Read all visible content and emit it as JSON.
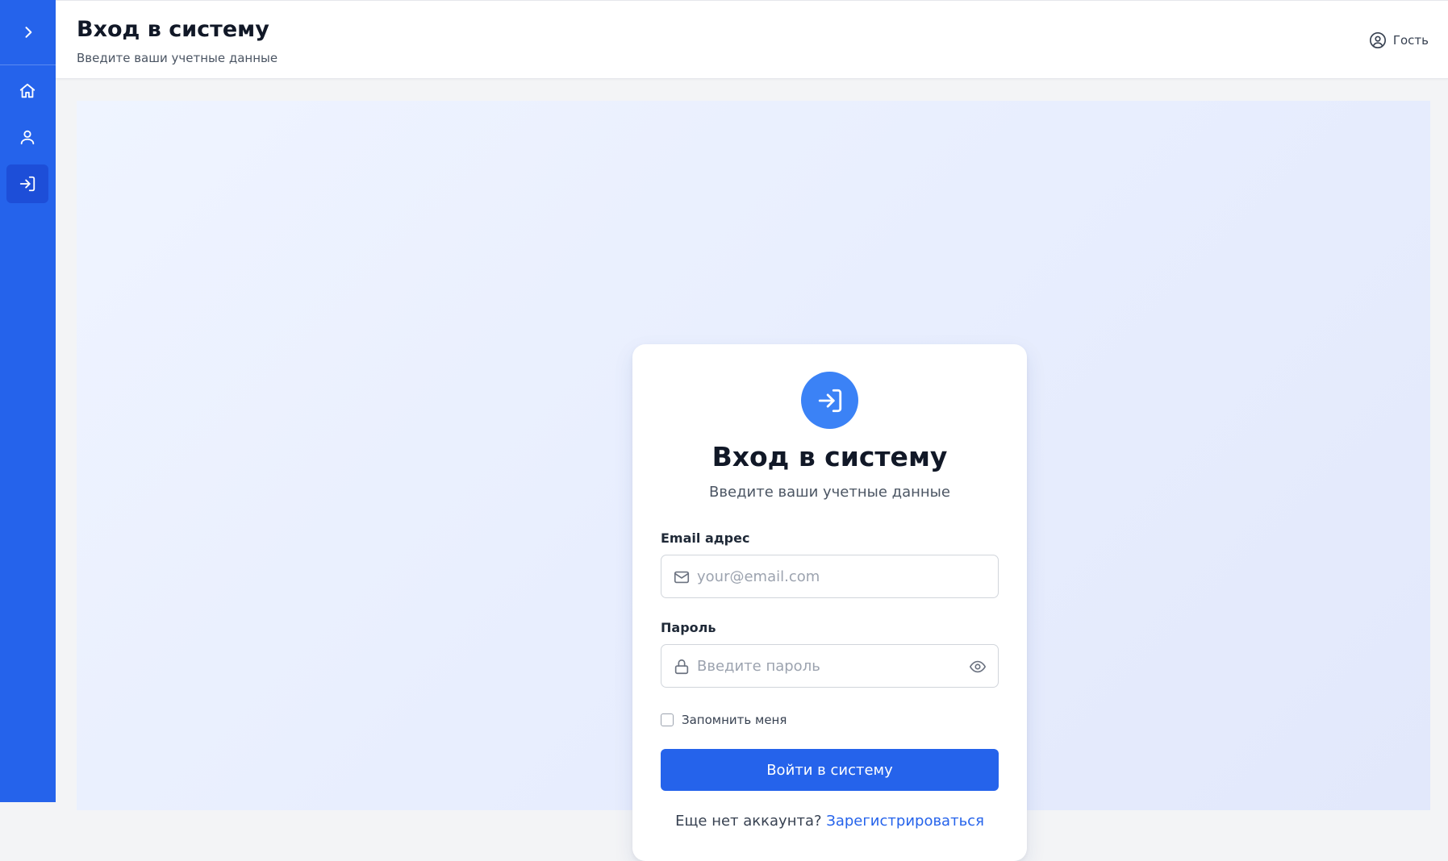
{
  "sidebar": {
    "toggle_icon": "chevron-right-icon",
    "items": [
      {
        "name": "home",
        "icon": "home-icon",
        "active": false
      },
      {
        "name": "profile",
        "icon": "user-icon",
        "active": false
      },
      {
        "name": "login",
        "icon": "login-icon",
        "active": true
      }
    ],
    "color": "#2563eb",
    "active_color": "#1d4ed8"
  },
  "header": {
    "title": "Вход в систему",
    "subtitle": "Введите ваши учетные данные",
    "user_icon": "user-circle-icon",
    "user_label": "Гость"
  },
  "login_card": {
    "icon": "login-icon",
    "title": "Вход в систему",
    "subtitle": "Введите ваши учетные данные",
    "email": {
      "label": "Email адрес",
      "placeholder": "your@email.com",
      "value": "",
      "icon": "mail-icon"
    },
    "password": {
      "label": "Пароль",
      "placeholder": "Введите пароль",
      "value": "",
      "icon": "lock-icon",
      "toggle_icon": "eye-icon"
    },
    "remember": {
      "label": "Запомнить меня",
      "checked": false
    },
    "submit_label": "Войти в систему",
    "signup_prompt": "Еще нет аккаунта?",
    "signup_link": "Зарегистрироваться"
  },
  "colors": {
    "primary": "#2563eb",
    "icon_circle": "#3b82f6",
    "background_gradient_start": "#eff4ff",
    "background_gradient_end": "#e2e8fb"
  }
}
